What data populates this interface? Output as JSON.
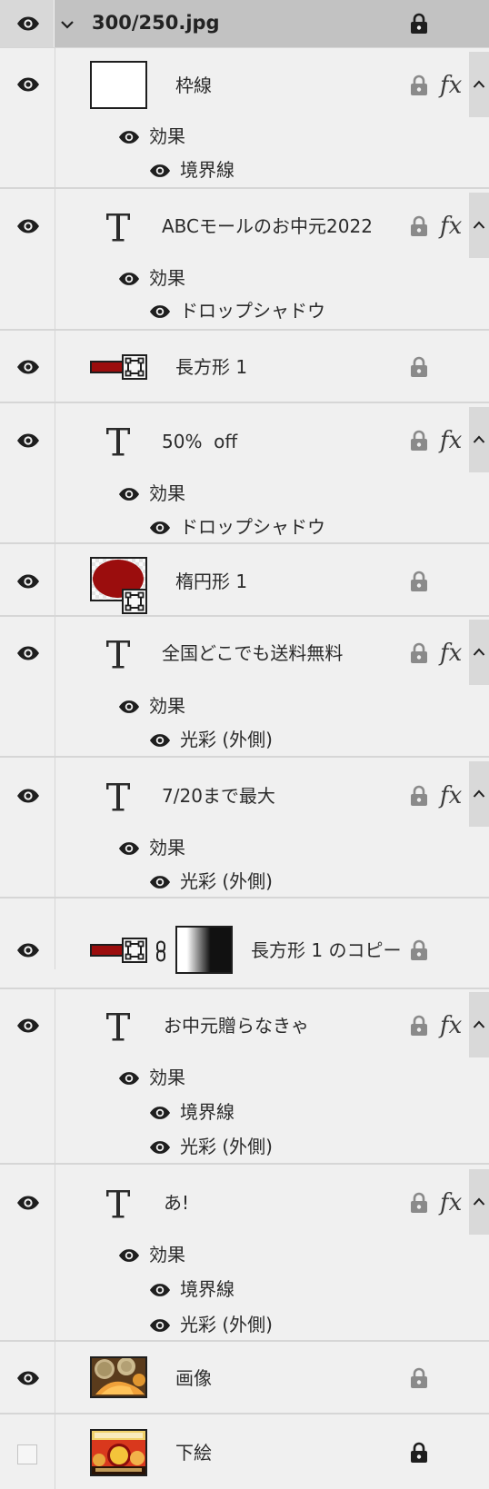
{
  "header": {
    "title": "300/250.jpg"
  },
  "effects_label": "効果",
  "layers": [
    {
      "name": "枠線",
      "type": "shape-white",
      "effects": [
        "境界線"
      ]
    },
    {
      "name": "ABCモールのお中元2022",
      "type": "text",
      "effects": [
        "ドロップシャドウ"
      ]
    },
    {
      "name": "長方形 1",
      "type": "rect"
    },
    {
      "name": "50%  off",
      "type": "text",
      "effects": [
        "ドロップシャドウ"
      ]
    },
    {
      "name": "楕円形 1",
      "type": "ellipse"
    },
    {
      "name": "全国どこでも送料無料",
      "type": "text",
      "effects": [
        "光彩 (外側)"
      ]
    },
    {
      "name": "7/20まで最大",
      "type": "text",
      "effects": [
        "光彩 (外側)"
      ]
    },
    {
      "name": "長方形 1 のコピー",
      "type": "rect-mask"
    },
    {
      "name": "お中元贈らなきゃ",
      "type": "text",
      "effects": [
        "境界線",
        "光彩 (外側)"
      ]
    },
    {
      "name": "あ!",
      "type": "text",
      "effects": [
        "境界線",
        "光彩 (外側)"
      ]
    },
    {
      "name": "画像",
      "type": "image"
    },
    {
      "name": "下絵",
      "type": "image-sketch",
      "visible": false
    }
  ],
  "colors": {
    "rect_red": "#9b0d0d",
    "lock_gray": "#8a8a8a",
    "lock_dark": "#1e1e1e",
    "header_bg": "#c2c2c2"
  },
  "icons": [
    "eye-icon",
    "chevron-down-icon",
    "lock-icon",
    "fx-icon",
    "chevron-up-icon",
    "text-layer-icon",
    "link-icon"
  ]
}
